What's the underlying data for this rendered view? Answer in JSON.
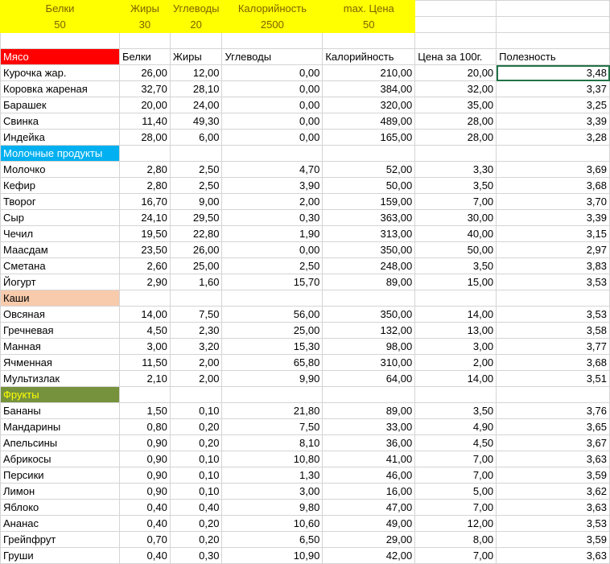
{
  "summary": {
    "labels": [
      "Белки",
      "Жиры",
      "Углеводы",
      "Калорийность",
      "max. Цена"
    ],
    "values": [
      "50",
      "30",
      "20",
      "2500",
      "50"
    ]
  },
  "headers": [
    "Мясо",
    "Белки",
    "Жиры",
    "Углеводы",
    "Калорийность",
    "Цена за 100г.",
    "Полезность"
  ],
  "colors": {
    "meat": "#ff0000",
    "dairy": "#00b0f0",
    "porridge": "#f8cbad",
    "fruit": "#76923c",
    "fruit_text": "#ffff00",
    "summary": "#ffff00"
  },
  "rows": [
    {
      "name": "Курочка жар.",
      "values": [
        "26,00",
        "12,00",
        "0,00",
        "210,00",
        "20,00",
        "3,48"
      ]
    },
    {
      "name": "Коровка жареная",
      "values": [
        "32,70",
        "28,10",
        "0,00",
        "384,00",
        "32,00",
        "3,37"
      ]
    },
    {
      "name": "Барашек",
      "values": [
        "20,00",
        "24,00",
        "0,00",
        "320,00",
        "35,00",
        "3,25"
      ]
    },
    {
      "name": "Свинка",
      "values": [
        "11,40",
        "49,30",
        "0,00",
        "489,00",
        "28,00",
        "3,39"
      ]
    },
    {
      "name": "Индейка",
      "values": [
        "28,00",
        "6,00",
        "0,00",
        "165,00",
        "28,00",
        "3,28"
      ]
    },
    {
      "category": "Молочные продукты",
      "style": "dairy"
    },
    {
      "name": "Молочко",
      "values": [
        "2,80",
        "2,50",
        "4,70",
        "52,00",
        "3,30",
        "3,69"
      ]
    },
    {
      "name": "Кефир",
      "values": [
        "2,80",
        "2,50",
        "3,90",
        "50,00",
        "3,50",
        "3,68"
      ]
    },
    {
      "name": "Творог",
      "values": [
        "16,70",
        "9,00",
        "2,00",
        "159,00",
        "7,00",
        "3,70"
      ]
    },
    {
      "name": "Сыр",
      "values": [
        "24,10",
        "29,50",
        "0,30",
        "363,00",
        "30,00",
        "3,39"
      ]
    },
    {
      "name": "Чечил",
      "values": [
        "19,50",
        "22,80",
        "1,90",
        "313,00",
        "40,00",
        "3,15"
      ]
    },
    {
      "name": "Маасдам",
      "values": [
        "23,50",
        "26,00",
        "0,00",
        "350,00",
        "50,00",
        "2,97"
      ]
    },
    {
      "name": "Сметана",
      "values": [
        "2,60",
        "25,00",
        "2,50",
        "248,00",
        "3,50",
        "3,83"
      ]
    },
    {
      "name": "Йогурт",
      "values": [
        "2,90",
        "1,60",
        "15,70",
        "89,00",
        "15,00",
        "3,53"
      ]
    },
    {
      "category": "Каши",
      "style": "porridge"
    },
    {
      "name": "Овсяная",
      "values": [
        "14,00",
        "7,50",
        "56,00",
        "350,00",
        "14,00",
        "3,53"
      ]
    },
    {
      "name": "Гречневая",
      "values": [
        "4,50",
        "2,30",
        "25,00",
        "132,00",
        "13,00",
        "3,58"
      ]
    },
    {
      "name": "Манная",
      "values": [
        "3,00",
        "3,20",
        "15,30",
        "98,00",
        "3,00",
        "3,77"
      ]
    },
    {
      "name": "Ячменная",
      "values": [
        "11,50",
        "2,00",
        "65,80",
        "310,00",
        "2,00",
        "3,68"
      ]
    },
    {
      "name": "Мультизлак",
      "values": [
        "2,10",
        "2,00",
        "9,90",
        "64,00",
        "14,00",
        "3,51"
      ]
    },
    {
      "category": "Фрукты",
      "style": "fruit"
    },
    {
      "name": "Бананы",
      "values": [
        "1,50",
        "0,10",
        "21,80",
        "89,00",
        "3,50",
        "3,76"
      ]
    },
    {
      "name": "Мандарины",
      "values": [
        "0,80",
        "0,20",
        "7,50",
        "33,00",
        "4,90",
        "3,65"
      ]
    },
    {
      "name": "Апельсины",
      "values": [
        "0,90",
        "0,20",
        "8,10",
        "36,00",
        "4,50",
        "3,67"
      ]
    },
    {
      "name": "Абрикосы",
      "values": [
        "0,90",
        "0,10",
        "10,80",
        "41,00",
        "7,00",
        "3,63"
      ]
    },
    {
      "name": "Персики",
      "values": [
        "0,90",
        "0,10",
        "1,30",
        "46,00",
        "7,00",
        "3,59"
      ]
    },
    {
      "name": "Лимон",
      "values": [
        "0,90",
        "0,10",
        "3,00",
        "16,00",
        "5,00",
        "3,62"
      ]
    },
    {
      "name": "Яблоко",
      "values": [
        "0,40",
        "0,40",
        "9,80",
        "47,00",
        "7,00",
        "3,63"
      ]
    },
    {
      "name": "Ананас",
      "values": [
        "0,40",
        "0,20",
        "10,60",
        "49,00",
        "12,00",
        "3,53"
      ]
    },
    {
      "name": "Грейпфрут",
      "values": [
        "0,70",
        "0,20",
        "6,50",
        "29,00",
        "8,00",
        "3,59"
      ]
    },
    {
      "name": "Груши",
      "values": [
        "0,40",
        "0,30",
        "10,90",
        "42,00",
        "7,00",
        "3,63"
      ]
    }
  ]
}
